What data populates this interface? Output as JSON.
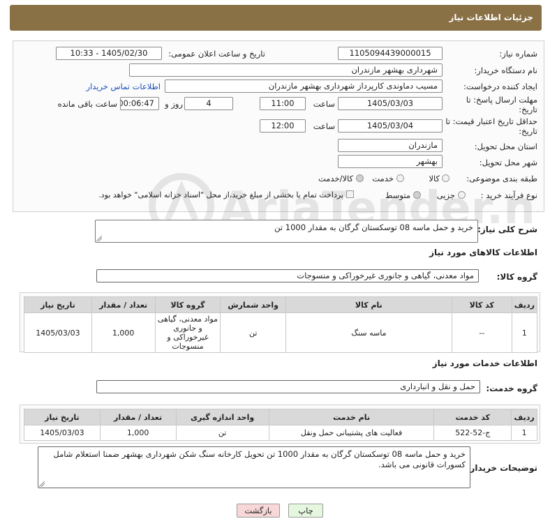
{
  "header": {
    "title": "جزئیات اطلاعات نیاز"
  },
  "fields": {
    "need_number_label": "شماره نیاز:",
    "need_number": "1105094439000015",
    "announce_label": "تاریخ و ساعت اعلان عمومی:",
    "announce_value": "1405/02/30 - 10:33",
    "buyer_org_label": "نام دستگاه خریدار:",
    "buyer_org": "شهرداری بهشهر مازندران",
    "creator_label": "ایجاد کننده درخواست:",
    "creator": "مسیب دماوندی کارپرداز شهرداری بهشهر مازندران",
    "contact_link": "اطلاعات تماس خریدار",
    "reply_deadline_label": "مهلت ارسال پاسخ: تا تاریخ:",
    "reply_date": "1405/03/03",
    "time_label": "ساعت",
    "reply_time": "11:00",
    "days": "4",
    "days_label": "روز و",
    "remaining": "00:06:47",
    "remaining_label": "ساعت باقی مانده",
    "price_deadline_label": "حداقل تاریخ اعتبار قیمت: تا تاریخ:",
    "price_date": "1405/03/04",
    "price_time": "12:00",
    "province_label": "استان محل تحویل:",
    "province": "مازندران",
    "city_label": "شهر محل تحویل:",
    "city": "بهشهر",
    "category_label": "طبقه بندی موضوعی:",
    "cat_options": [
      "کالا",
      "خدمت",
      "کالا/خدمت"
    ],
    "process_label": "نوع فرآیند خرید :",
    "process_options": [
      "جزیی",
      "متوسط"
    ],
    "payment_note": "پرداخت تمام یا بخشی از مبلغ خرید،از محل \"اسناد خزانه اسلامی\" خواهد بود."
  },
  "description": {
    "label": "شرح کلی نیاز:",
    "value": "خرید و حمل ماسه 08 توسکستان گرگان به مقدار 1000 تن"
  },
  "goods": {
    "section_title": "اطلاعات کالاهای مورد نیاز",
    "group_label": "گروه کالا:",
    "group_value": "مواد معدنی، گیاهی و جانوری غیرخوراکی و منسوجات",
    "headers": [
      "ردیف",
      "کد کالا",
      "نام کالا",
      "واحد شمارش",
      "گروه کالا",
      "تعداد / مقدار",
      "تاریخ نیاز"
    ],
    "rows": [
      [
        "1",
        "--",
        "ماسه سنگ",
        "تن",
        "مواد معدنی، گیاهی و جانوری غیرخوراکی و منسوجات",
        "1,000",
        "1405/03/03"
      ]
    ]
  },
  "services": {
    "section_title": "اطلاعات خدمات مورد نیاز",
    "group_label": "گروه خدمت:",
    "group_value": "حمل و نقل و انبارداری",
    "headers": [
      "ردیف",
      "کد خدمت",
      "نام خدمت",
      "واحد اندازه گیری",
      "تعداد / مقدار",
      "تاریخ نیاز"
    ],
    "rows": [
      [
        "1",
        "ج-52-522",
        "فعالیت های پشتیبانی حمل ونقل",
        "تن",
        "1,000",
        "1405/03/03"
      ]
    ]
  },
  "buyer_notes": {
    "label": "توضیحات خریدار:",
    "value": "خرید و حمل ماسه 08 توسکستان گرگان به مقدار 1000 تن  تحویل کارخانه سنگ شکن شهرداری بهشهر ضمنا استعلام شامل کسورات قانونی می باشد."
  },
  "buttons": {
    "print": "چاپ",
    "back": "بازگشت"
  },
  "watermark": {
    "text": "AriaTender.net"
  },
  "colors": {
    "header_bg": "#8a7045",
    "link": "#1a4fb8",
    "back_btn_bg": "#f7d7d7",
    "print_btn_bg": "#e6f7e0"
  }
}
